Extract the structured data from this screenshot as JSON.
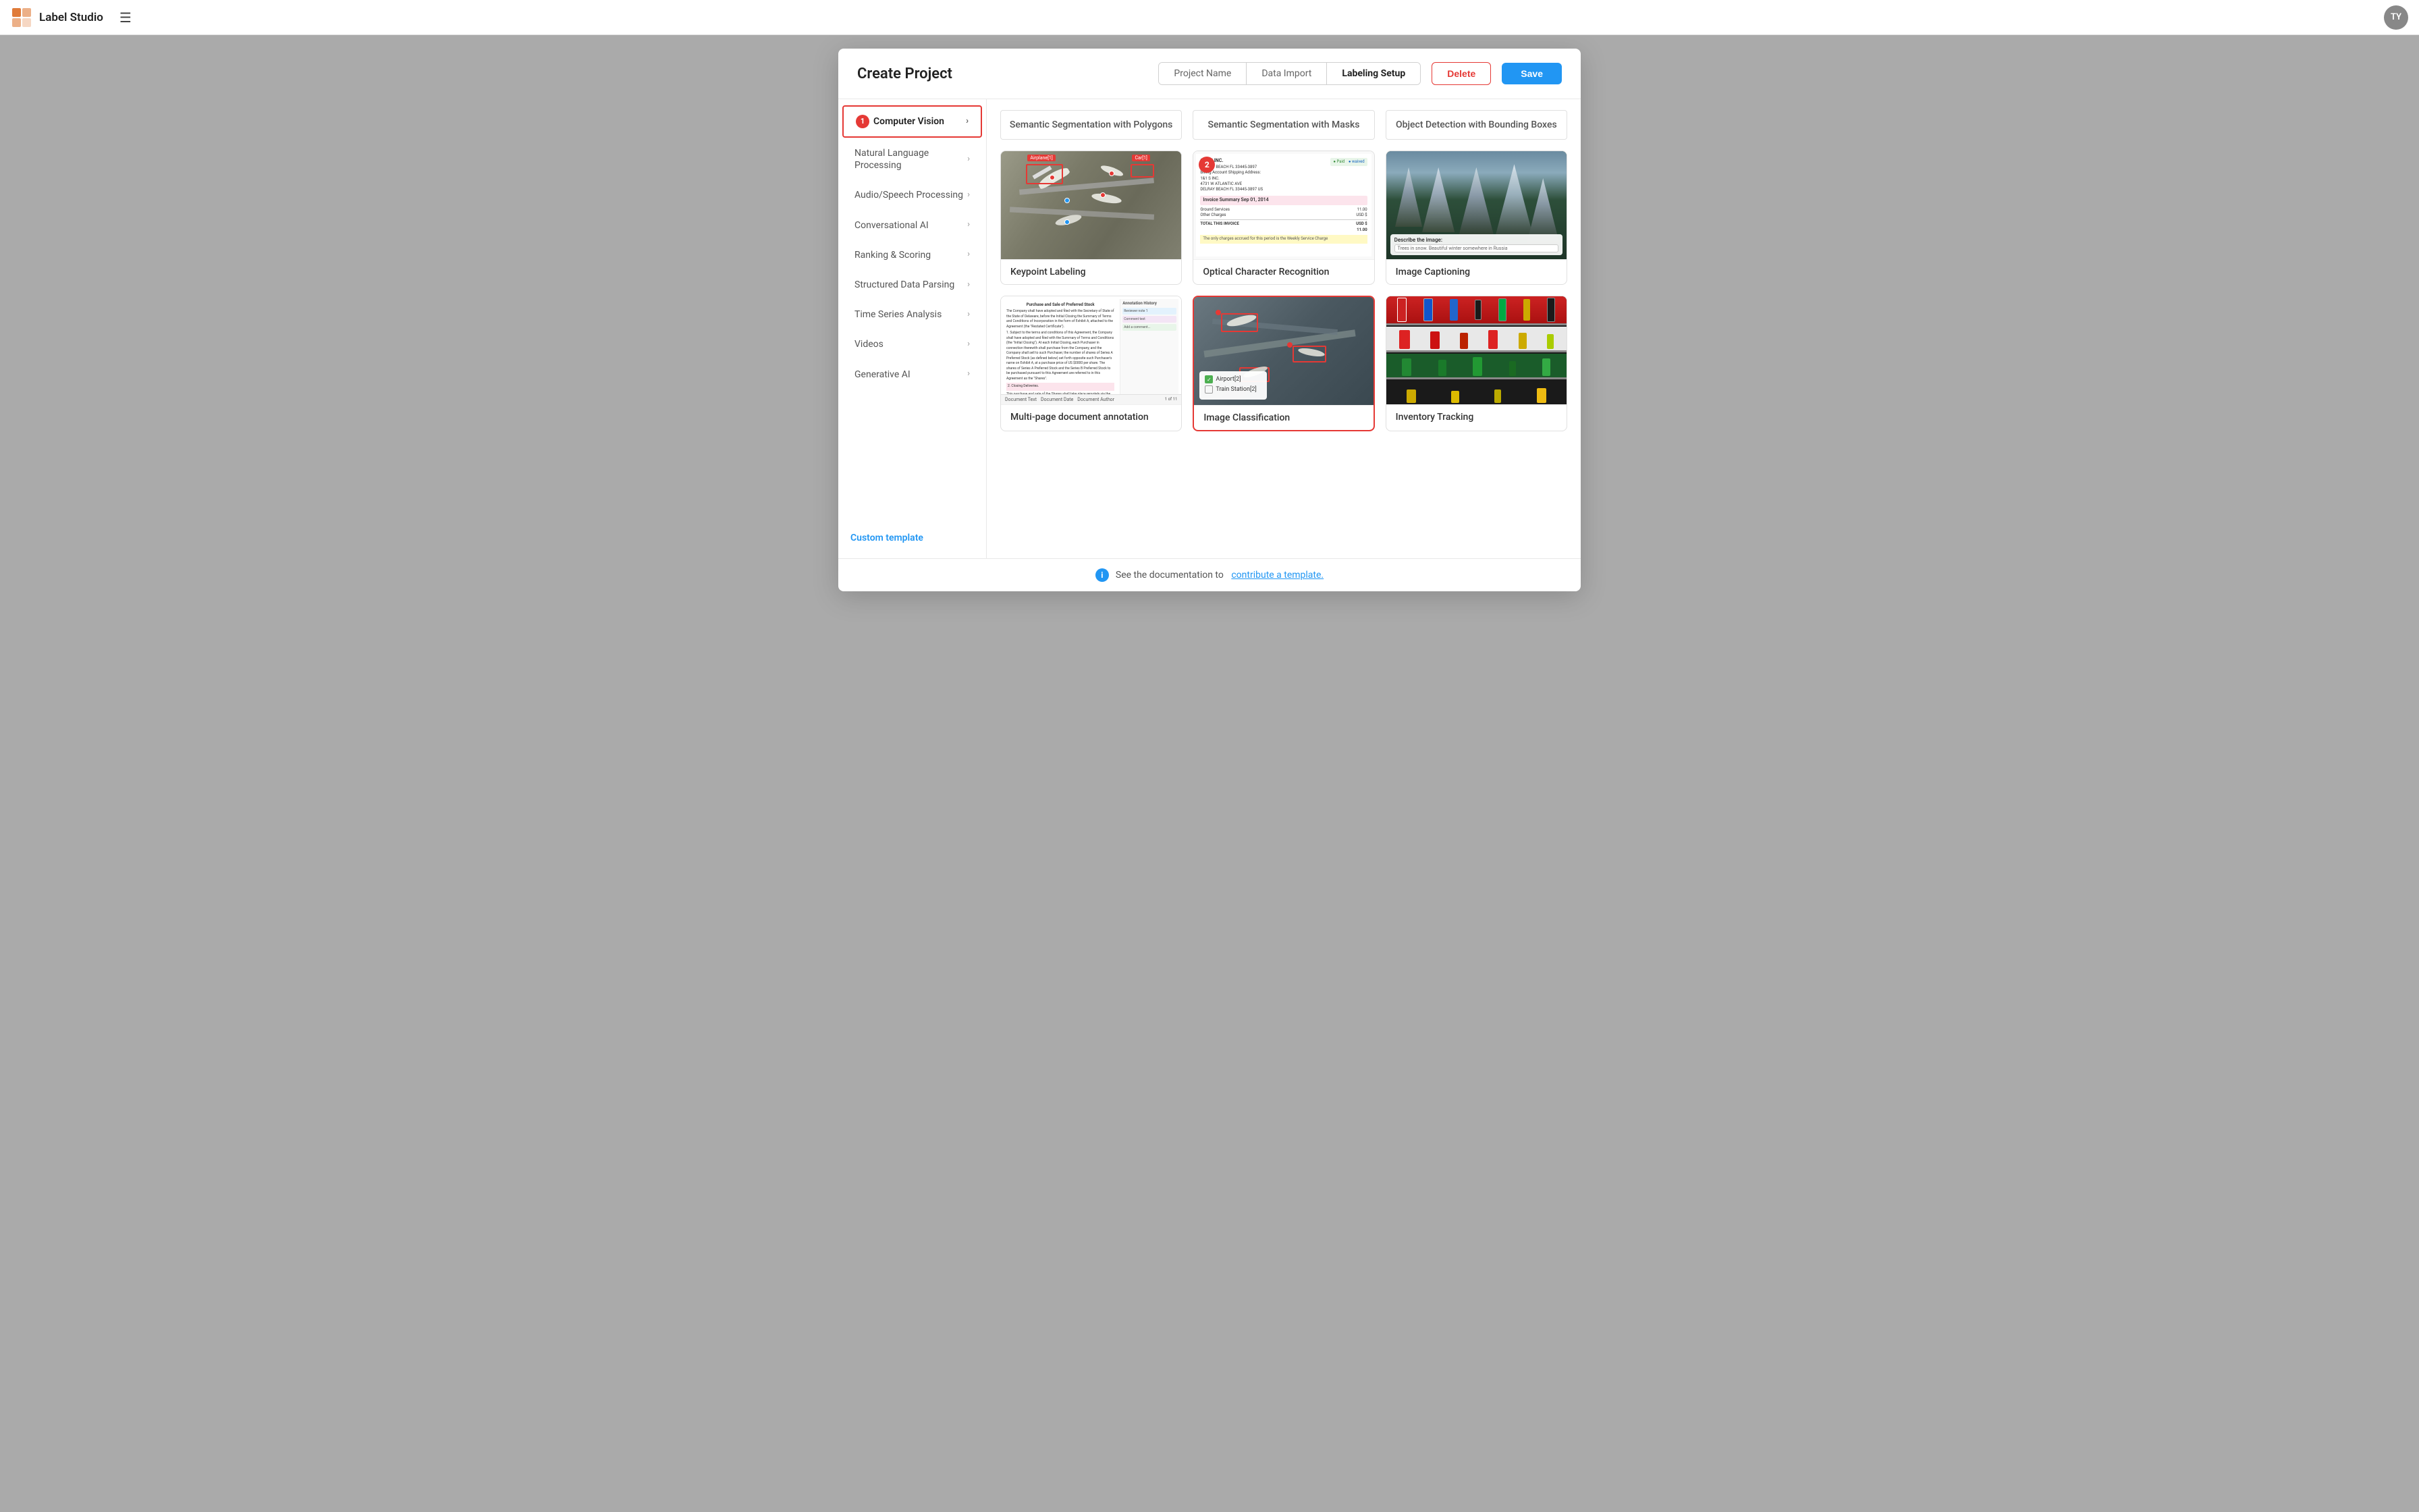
{
  "app": {
    "title": "Label Studio",
    "user_initials": "TY"
  },
  "modal": {
    "title": "Create Project",
    "tabs": [
      {
        "id": "project-name",
        "label": "Project Name",
        "active": false
      },
      {
        "id": "data-import",
        "label": "Data Import",
        "active": false
      },
      {
        "id": "labeling-setup",
        "label": "Labeling Setup",
        "active": true
      }
    ],
    "btn_delete": "Delete",
    "btn_save": "Save"
  },
  "sidebar": {
    "items": [
      {
        "id": "computer-vision",
        "label": "Computer Vision",
        "active": true
      },
      {
        "id": "nlp",
        "label": "Natural Language Processing",
        "active": false
      },
      {
        "id": "audio-speech",
        "label": "Audio/Speech Processing",
        "active": false
      },
      {
        "id": "conversational-ai",
        "label": "Conversational AI",
        "active": false
      },
      {
        "id": "ranking-scoring",
        "label": "Ranking & Scoring",
        "active": false
      },
      {
        "id": "structured-data",
        "label": "Structured Data Parsing",
        "active": false
      },
      {
        "id": "time-series",
        "label": "Time Series Analysis",
        "active": false
      },
      {
        "id": "videos",
        "label": "Videos",
        "active": false
      },
      {
        "id": "generative-ai",
        "label": "Generative AI",
        "active": false
      }
    ],
    "custom_template_label": "Custom template"
  },
  "top_partial_cards": [
    {
      "label": "Semantic Segmentation with Polygons"
    },
    {
      "label": "Semantic Segmentation with Masks"
    },
    {
      "label": "Object Detection with Bounding Boxes"
    }
  ],
  "template_rows": [
    [
      {
        "id": "keypoint-labeling",
        "label": "Keypoint Labeling",
        "image_type": "airport",
        "selected": false,
        "step_badge": null
      },
      {
        "id": "ocr",
        "label": "Optical Character Recognition",
        "image_type": "invoice",
        "selected": false,
        "step_badge": "2"
      },
      {
        "id": "image-captioning",
        "label": "Image Captioning",
        "image_type": "caption",
        "selected": false,
        "step_badge": null
      }
    ],
    [
      {
        "id": "multipage-doc",
        "label": "Multi-page document annotation",
        "image_type": "document",
        "selected": false,
        "step_badge": null
      },
      {
        "id": "image-classification",
        "label": "Image Classification",
        "image_type": "classify",
        "selected": true,
        "step_badge": null
      },
      {
        "id": "inventory-tracking",
        "label": "Inventory Tracking",
        "image_type": "inventory",
        "selected": false,
        "step_badge": null
      }
    ]
  ],
  "footer": {
    "text": "See the documentation to",
    "link_text": "contribute a template.",
    "full_text": "See the documentation to contribute a template."
  },
  "colors": {
    "accent_red": "#e53935",
    "accent_blue": "#2196f3",
    "border": "#e0e0e0",
    "text_primary": "#222",
    "text_secondary": "#555"
  }
}
